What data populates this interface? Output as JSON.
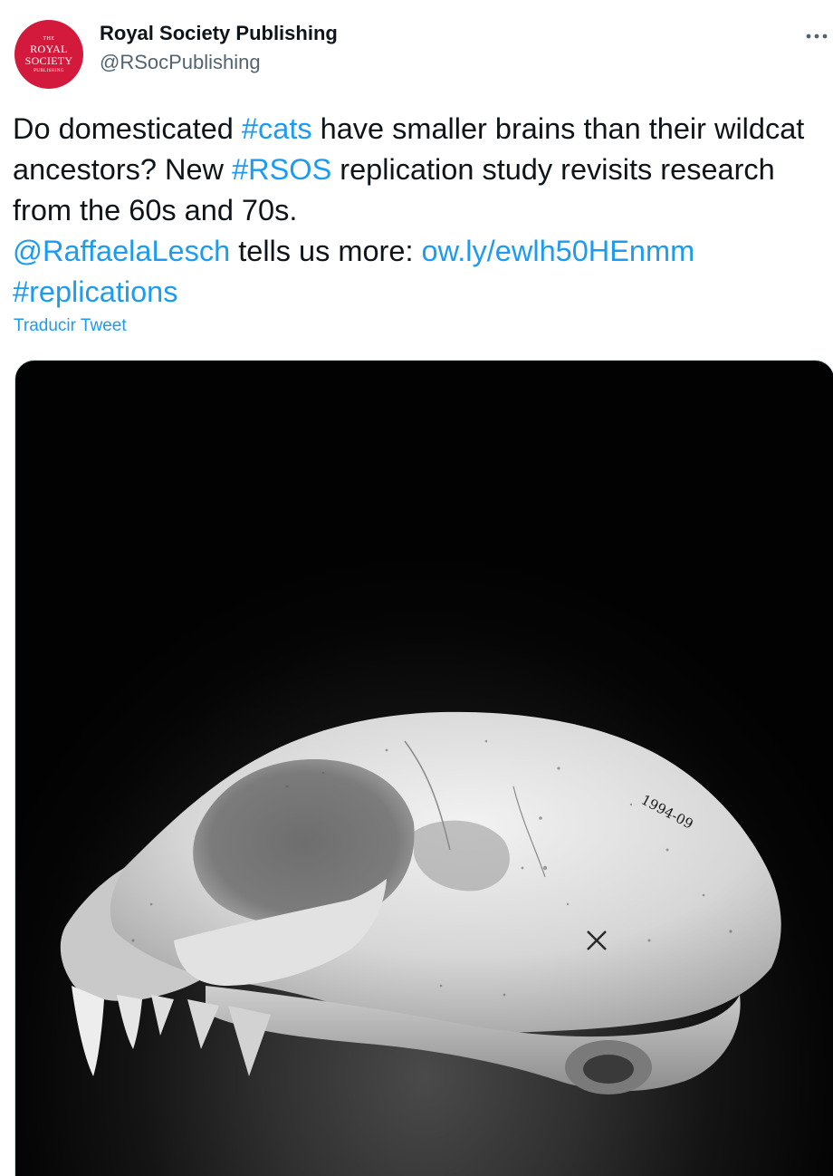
{
  "author": {
    "display_name": "Royal Society Publishing",
    "handle": "@RSocPublishing",
    "avatar_lines": [
      "THE",
      "ROYAL",
      "SOCIETY",
      "PUBLISHING"
    ],
    "avatar_color": "#d41a3c"
  },
  "more_icon": "more-horizontal-icon",
  "tweet": {
    "segments": [
      {
        "text": "Do domesticated ",
        "link": false
      },
      {
        "text": "#cats",
        "link": true
      },
      {
        "text": " have smaller brains than their wildcat ancestors? New ",
        "link": false
      },
      {
        "text": "#RSOS",
        "link": true
      },
      {
        "text": " replication study revisits research from the 60s and 70s. ",
        "link": false
      },
      {
        "text": "@RaffaelaLesch",
        "link": true
      },
      {
        "text": " tells us more: ",
        "link": false
      },
      {
        "text": "ow.ly/ewlh50HEnmm",
        "link": true
      },
      {
        "text": " ",
        "link": false
      },
      {
        "text": "#replications",
        "link": true
      }
    ],
    "translate_label": "Traducir Tweet"
  },
  "media": {
    "specimen_label": "1994-09"
  },
  "colors": {
    "link": "#1d9bf0",
    "text": "#0f1419",
    "secondary": "#536471"
  }
}
